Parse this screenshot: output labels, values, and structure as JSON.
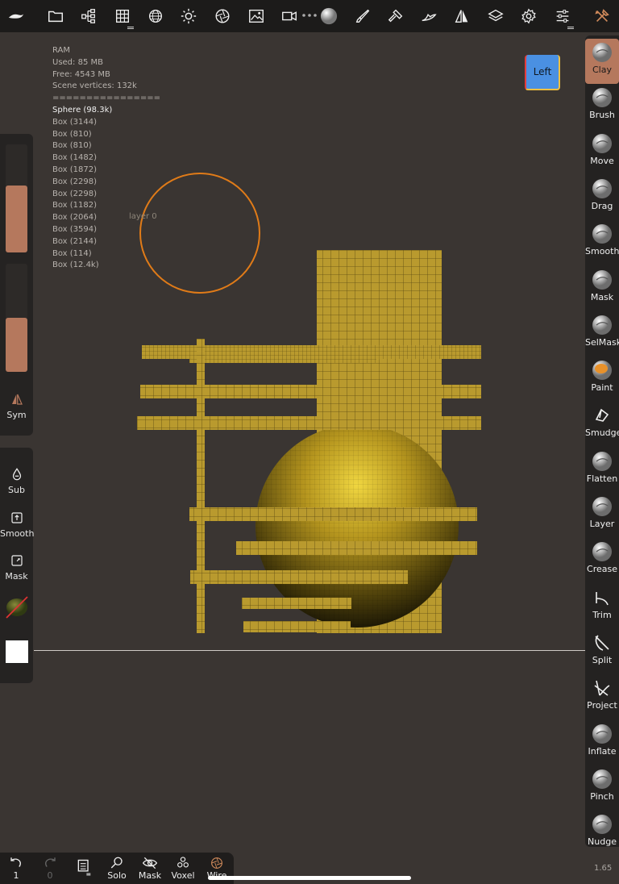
{
  "top_bar": {
    "icons": [
      "nomad-logo-icon",
      "folder-icon",
      "scene-tree-icon",
      "grid-icon",
      "sphere-wire-icon",
      "sun-icon",
      "shutter-icon",
      "image-icon",
      "camera-icon",
      "matcap-icon",
      "brush-icon",
      "hammer-icon",
      "wing-icon",
      "symmetry-icon",
      "layers-icon",
      "gear-icon",
      "sliders-icon",
      "tools-icon"
    ]
  },
  "stats": {
    "ram_label": "RAM",
    "used": "Used: 85 MB",
    "free": "Free: 4543 MB",
    "vertices": "Scene vertices: 132k",
    "separator": "================",
    "selected_object": "Sphere (98.3k)",
    "objects": [
      "Box (3144)",
      "Box (810)",
      "Box (810)",
      "Box (1482)",
      "Box (1872)",
      "Box (2298)",
      "Box (2298)",
      "Box (1182)",
      "Box (2064)",
      "Box (3594)",
      "Box (2144)",
      "Box (114)",
      "Box (12.4k)"
    ]
  },
  "layer_label": "layer 0",
  "view_cube": {
    "label": "Left"
  },
  "left_panel": {
    "sym_label": "Sym",
    "sub_label": "Sub",
    "smooth_label": "Smooth",
    "mask_label": "Mask",
    "slider_radius_level": 0.62,
    "slider_intensity_level": 0.5,
    "accent_color": "#b5785d"
  },
  "tools": [
    {
      "label": "Clay",
      "icon": "clay-icon",
      "active": true
    },
    {
      "label": "Brush",
      "icon": "brush-sphere-icon"
    },
    {
      "label": "Move",
      "icon": "move-sphere-icon"
    },
    {
      "label": "Drag",
      "icon": "drag-sphere-icon"
    },
    {
      "label": "Smooth",
      "icon": "smooth-sphere-icon"
    },
    {
      "label": "Mask",
      "icon": "mask-sphere-icon"
    },
    {
      "label": "SelMask",
      "icon": "selmask-sphere-icon"
    },
    {
      "label": "Paint",
      "icon": "paint-sphere-icon"
    },
    {
      "label": "Smudge",
      "icon": "smudge-icon"
    },
    {
      "label": "Flatten",
      "icon": "flatten-sphere-icon"
    },
    {
      "label": "Layer",
      "icon": "layer-sphere-icon"
    },
    {
      "label": "Crease",
      "icon": "crease-sphere-icon"
    },
    {
      "label": "Trim",
      "icon": "trim-icon"
    },
    {
      "label": "Split",
      "icon": "split-icon"
    },
    {
      "label": "Project",
      "icon": "project-icon"
    },
    {
      "label": "Inflate",
      "icon": "inflate-sphere-icon"
    },
    {
      "label": "Pinch",
      "icon": "pinch-sphere-icon"
    },
    {
      "label": "Nudge",
      "icon": "nudge-sphere-icon"
    }
  ],
  "bottom_bar": {
    "undo_count": "1",
    "redo_count": "0",
    "solo_label": "Solo",
    "mask_label": "Mask",
    "voxel_label": "Voxel",
    "wire_label": "Wire"
  },
  "version": "1.65"
}
